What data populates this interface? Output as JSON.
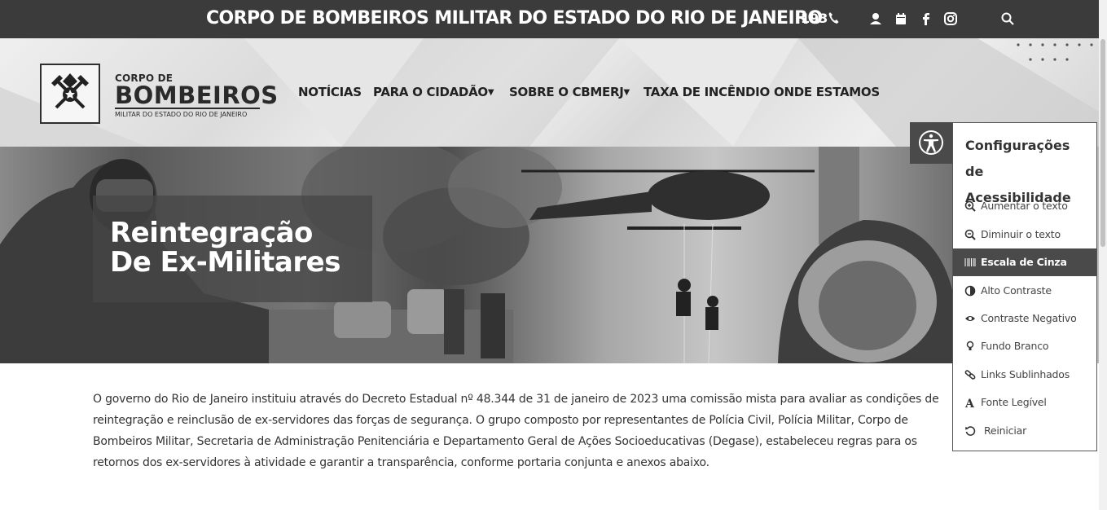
{
  "topbar": {
    "title": "CORPO DE BOMBEIROS MILITAR DO ESTADO DO RIO DE JANEIRO",
    "phone": "193",
    "icons": [
      "phone-icon",
      "user-icon",
      "calendar-icon",
      "facebook-icon",
      "instagram-icon",
      "search-icon"
    ]
  },
  "logo": {
    "line1": "CORPO DE",
    "line2": "BOMBEIROS",
    "line3": "MILITAR DO ESTADO DO RIO DE JANEIRO"
  },
  "nav": [
    {
      "label": "NOTÍCIAS"
    },
    {
      "label": "PARA O CIDADÃO",
      "dropdown": true
    },
    {
      "label": "SOBRE O CBMERJ",
      "dropdown": true
    },
    {
      "label": "TAXA DE INCÊNDIO"
    },
    {
      "label": "ONDE ESTAMOS"
    }
  ],
  "banner": {
    "title_line1": "Reintegração",
    "title_line2": "De Ex-Militares"
  },
  "content": {
    "paragraph": "O governo do Rio de Janeiro instituiu através do Decreto Estadual nº 48.344 de 31 de janeiro de 2023 uma comissão mista para avaliar as condições de reintegração e reinclusão de ex-servidores das forças de segurança. O grupo composto por representantes de Polícia Civil, Polícia Militar, Corpo de Bombeiros Militar, Secretaria de Administração Penitenciária e Departamento Geral de Ações Socioeducativas (Degase), estabeleceu regras para os retornos dos ex-servidores à atividade e garantir a transparência, conforme portaria conjunta e anexos abaixo."
  },
  "accessibility": {
    "title": "Configurações de Acessibilidade",
    "items": [
      {
        "label": "Aumentar o texto",
        "icon": "zoom-in-icon"
      },
      {
        "label": "Diminuir o texto",
        "icon": "zoom-out-icon"
      },
      {
        "label": "Escala de Cinza",
        "icon": "grayscale-icon",
        "active": true
      },
      {
        "label": "Alto Contraste",
        "icon": "contrast-icon"
      },
      {
        "label": "Contraste Negativo",
        "icon": "eye-icon"
      },
      {
        "label": "Fundo Branco",
        "icon": "lightbulb-icon"
      },
      {
        "label": "Links Sublinhados",
        "icon": "link-icon"
      },
      {
        "label": "Fonte Legível",
        "icon": "font-icon"
      },
      {
        "label": "Reiniciar",
        "icon": "reset-icon"
      }
    ]
  },
  "colors": {
    "topbar": "#3b3b3b",
    "panel_active": "#4a4a4a",
    "text": "#333333"
  }
}
